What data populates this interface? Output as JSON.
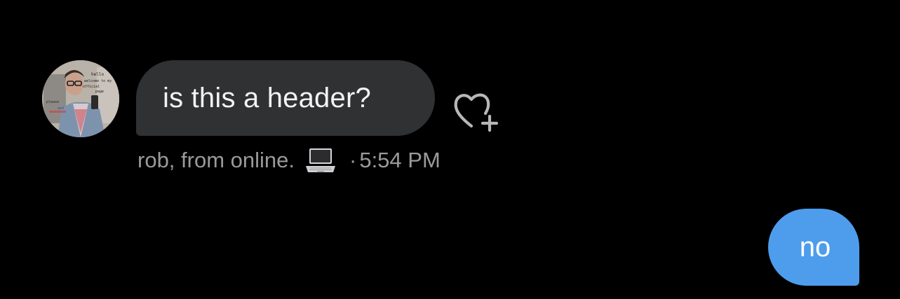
{
  "incoming_message": {
    "text": "is this a header?",
    "sender": "rob, from online.",
    "sender_emoji": "laptop-icon",
    "separator": "·",
    "time": "5:54 PM",
    "bubble_color": "#2f3133",
    "avatar_text": [
      "hello",
      "welcome to my",
      "official",
      "page",
      "please",
      "and"
    ]
  },
  "reaction_button": {
    "icon": "heart-plus-icon"
  },
  "outgoing_message": {
    "text": "no",
    "bubble_color": "#4e9ded"
  },
  "colors": {
    "background": "#000000",
    "meta_text": "#9a9a9d"
  }
}
